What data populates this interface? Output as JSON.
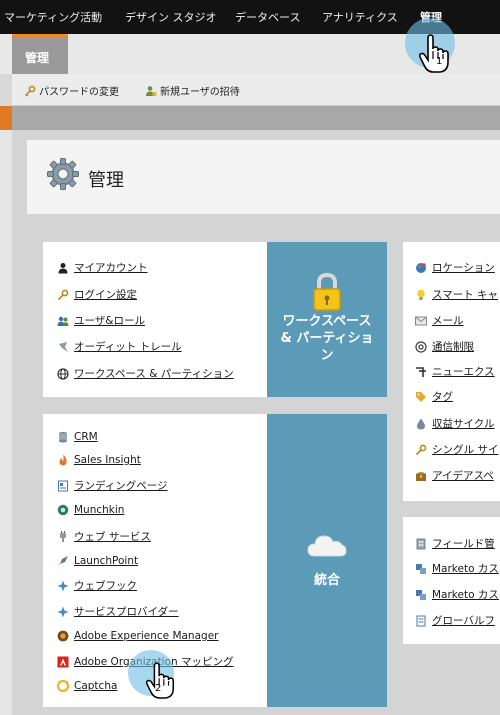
{
  "topnav": {
    "items": [
      "マーケティング活動",
      "デザイン スタジオ",
      "データベース",
      "アナリティクス",
      "管理"
    ]
  },
  "tab": {
    "label": "管理"
  },
  "toolbar": {
    "change_password": "パスワードの変更",
    "invite_user": "新規ユーザの招待"
  },
  "page": {
    "title": "管理"
  },
  "panel1": {
    "links": [
      "マイアカウント",
      "ログイン設定",
      "ユーザ&ロール",
      "オーディット トレール",
      "ワークスペース & パーティション"
    ],
    "tile": [
      "ワークスペース",
      "& パーティショ",
      "ン"
    ]
  },
  "panel2": {
    "links": [
      "CRM",
      "Sales Insight",
      "ランディングページ",
      "Munchkin",
      "ウェブ サービス",
      "LaunchPoint",
      "ウェブフック",
      "サービスプロバイダー",
      "Adobe Experience Manager",
      "Adobe Organization マッピング",
      "Captcha"
    ],
    "tile": "統合"
  },
  "panel3": {
    "links": [
      "ロケーション",
      "スマート キャ",
      "メール",
      "通信制限",
      "ニューエクス",
      "タグ",
      "収益サイクル",
      "シングル サイ",
      "アイデアスペ"
    ]
  },
  "panel4": {
    "links": [
      "フィールド管",
      "Marketo カス",
      "Marketo カス",
      "グローバルフ"
    ]
  },
  "cursors": {
    "step1": "1",
    "step2": "2"
  },
  "colors": {
    "accent": "#f08a24",
    "tile": "#5b9bb8",
    "topnav": "#121212",
    "highlight": "#6ebee6"
  }
}
